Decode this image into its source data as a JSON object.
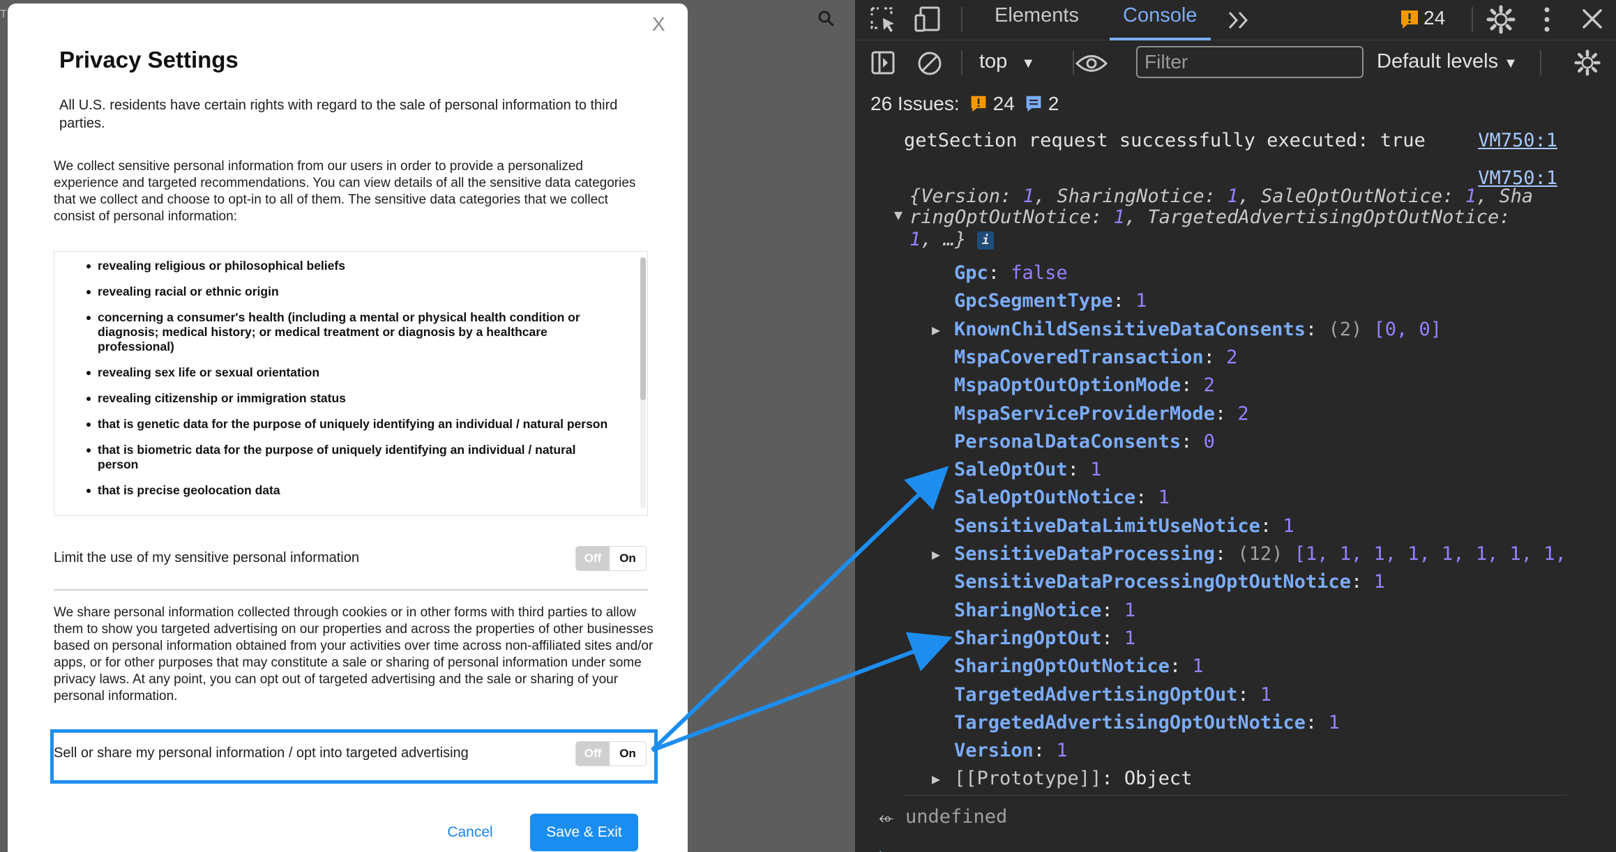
{
  "background": {
    "left_edge_glyph": "T"
  },
  "modal": {
    "close_label": "X",
    "title": "Privacy Settings",
    "intro": "All U.S. residents have certain rights with regard to the sale of personal information to third parties.",
    "collect_text": "We collect sensitive personal information from our users in order to provide a personalized experience and targeted recommendations. You can view details of all the sensitive data categories that we collect and choose to opt-in to all of them. The sensitive data categories that we collect consist of personal information:",
    "categories": [
      "revealing religious or philosophical beliefs",
      "revealing racial or ethnic origin",
      "concerning a consumer's health (including a mental or physical health condition or diagnosis; medical history; or medical treatment or diagnosis by a healthcare professional)",
      "revealing sex life or sexual orientation",
      "revealing citizenship or immigration status",
      "that is genetic data for the purpose of uniquely identifying an individual / natural person",
      "that is biometric data for the purpose of uniquely identifying an individual / natural person",
      "that is precise geolocation data"
    ],
    "limit_toggle": {
      "label": "Limit the use of my sensitive personal information",
      "off": "Off",
      "on": "On"
    },
    "share_text": "We share personal information collected through cookies or in other forms with third parties to allow them to show you targeted advertising on our properties and across the properties of other businesses based on personal information obtained from your activities over time across non-affiliated sites and/or apps, or for other purposes that may constitute a sale or sharing of personal information under some privacy laws. At any point, you can opt out of targeted advertising and the sale or sharing of your personal information.",
    "sell_toggle": {
      "label": "Sell or share my personal information / opt into targeted advertising",
      "off": "Off",
      "on": "On"
    },
    "cancel_label": "Cancel",
    "save_label": "Save & Exit",
    "accent_color": "#1a8df0"
  },
  "devtools": {
    "tabs": {
      "elements": "Elements",
      "console": "Console"
    },
    "issue_badge_count": "24",
    "toolbar": {
      "context": "top",
      "filter_placeholder": "Filter",
      "levels": "Default levels"
    },
    "issues_bar": {
      "label": "26 Issues:",
      "warnings": "24",
      "infos": "2"
    },
    "console": {
      "log_message": "getSection request successfully executed: true",
      "source_link_1": "VM750:1",
      "source_link_2": "VM750:1",
      "object_preview": {
        "line1_open": "{",
        "line1": [
          {
            "key": "Version",
            "value": "1"
          },
          {
            "key": "SharingNotice",
            "value": "1"
          },
          {
            "key": "SaleOptOutNotice",
            "value": "1"
          }
        ],
        "line1_tail_key": "Sha",
        "line2_head_key": "ringOptOutNotice",
        "line2_head_value": "1",
        "line2_key": "TargetedAdvertisingOptOutNotice",
        "line3_value": "1",
        "line3_tail": ", …}",
        "info_badge": "i"
      },
      "properties": [
        {
          "key": "Gpc",
          "value": "false",
          "expandable": false
        },
        {
          "key": "GpcSegmentType",
          "value": "1",
          "expandable": false
        },
        {
          "key": "KnownChildSensitiveDataConsents",
          "count": "(2)",
          "value": "[0, 0]",
          "expandable": true
        },
        {
          "key": "MspaCoveredTransaction",
          "value": "2",
          "expandable": false
        },
        {
          "key": "MspaOptOutOptionMode",
          "value": "2",
          "expandable": false
        },
        {
          "key": "MspaServiceProviderMode",
          "value": "2",
          "expandable": false
        },
        {
          "key": "PersonalDataConsents",
          "value": "0",
          "expandable": false
        },
        {
          "key": "SaleOptOut",
          "value": "1",
          "expandable": false
        },
        {
          "key": "SaleOptOutNotice",
          "value": "1",
          "expandable": false
        },
        {
          "key": "SensitiveDataLimitUseNotice",
          "value": "1",
          "expandable": false
        },
        {
          "key": "SensitiveDataProcessing",
          "count": "(12)",
          "value": "[1, 1, 1, 1, 1, 1, 1, 1,",
          "expandable": true
        },
        {
          "key": "SensitiveDataProcessingOptOutNotice",
          "value": "1",
          "expandable": false
        },
        {
          "key": "SharingNotice",
          "value": "1",
          "expandable": false
        },
        {
          "key": "SharingOptOut",
          "value": "1",
          "expandable": false
        },
        {
          "key": "SharingOptOutNotice",
          "value": "1",
          "expandable": false
        },
        {
          "key": "TargetedAdvertisingOptOut",
          "value": "1",
          "expandable": false
        },
        {
          "key": "TargetedAdvertisingOptOutNotice",
          "value": "1",
          "expandable": false
        },
        {
          "key": "Version",
          "value": "1",
          "expandable": false
        },
        {
          "key": "[[Prototype]]",
          "value": "Object",
          "expandable": true
        }
      ],
      "return_value": "undefined"
    }
  }
}
